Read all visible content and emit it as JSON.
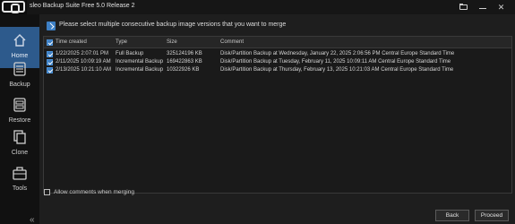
{
  "app": {
    "title": "sleo Backup Suite Free 5.0 Release 2"
  },
  "titlebar": {
    "icons": [
      "folder-icon",
      "minimize-icon",
      "close-icon"
    ]
  },
  "sidebar": {
    "items": [
      {
        "label": "Home",
        "icon": "home-icon",
        "active": true
      },
      {
        "label": "Backup",
        "icon": "backup-icon",
        "active": false
      },
      {
        "label": "Restore",
        "icon": "restore-icon",
        "active": false
      },
      {
        "label": "Clone",
        "icon": "clone-icon",
        "active": false
      },
      {
        "label": "Tools",
        "icon": "tools-icon",
        "active": false
      }
    ],
    "collapse": "«"
  },
  "main": {
    "instruction": "Please select multiple consecutive backup image versions that you want to merge",
    "table": {
      "columns": [
        "Time created",
        "Type",
        "Size",
        "Comment"
      ],
      "rows": [
        {
          "checked": true,
          "time": "1/22/2025 2:07:01 PM",
          "type": "Full Backup",
          "size": "325124196 KB",
          "comment": "Disk/Partition Backup at Wednesday, January 22, 2025 2:06:56 PM Central Europe Standard Time"
        },
        {
          "checked": true,
          "time": "2/11/2025 10:09:19 AM",
          "type": "Incremental Backup",
          "size": "169422863 KB",
          "comment": "Disk/Partition Backup at Tuesday, February 11, 2025 10:09:11 AM Central Europe Standard Time"
        },
        {
          "checked": true,
          "time": "2/13/2025 10:21:10 AM",
          "type": "Incremental Backup",
          "size": "10322926 KB",
          "comment": "Disk/Partition Backup at Thursday, February 13, 2025 10:21:03 AM Central Europe Standard Time"
        }
      ]
    },
    "allow_comments_label": "Allow comments when merging",
    "back_label": "Back",
    "proceed_label": "Proceed"
  },
  "colors": {
    "accent": "#2d5a8c",
    "checkbox": "#3d7fc4",
    "background": "#1e1e1e",
    "sidebar": "#111111"
  }
}
